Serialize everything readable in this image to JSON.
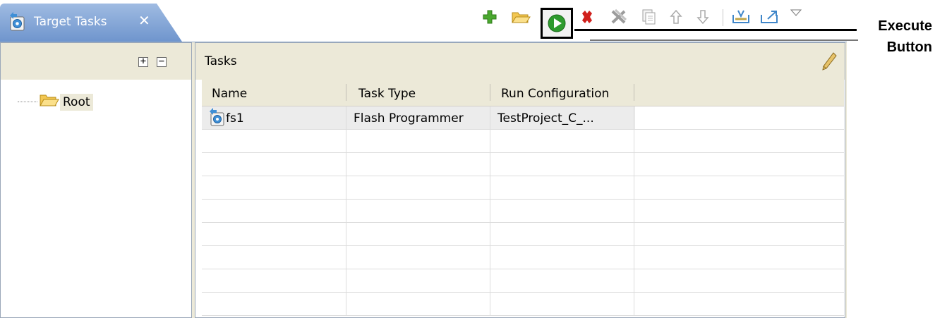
{
  "view": {
    "tab_title": "Target Tasks",
    "tab_close": "✕"
  },
  "toolbar": {
    "icons": [
      "add-icon",
      "open-folder-icon",
      "execute-icon",
      "delete-icon",
      "delete-all-icon",
      "copy-icon",
      "move-up-icon",
      "move-down-icon",
      "import-icon",
      "export-icon",
      "view-menu-icon"
    ]
  },
  "tree": {
    "expand_all": "+",
    "collapse_all": "−",
    "root_label": "Root"
  },
  "tasks": {
    "title": "Tasks",
    "columns": [
      "Name",
      "Task Type",
      "Run Configuration"
    ],
    "rows": [
      {
        "name": "fs1",
        "type": "Flash Programmer",
        "config": "TestProject_C_..."
      }
    ],
    "empty_rows": 8
  },
  "annotation": {
    "line1": "Execute",
    "line2": "Button"
  },
  "colors": {
    "tab_gradient_top": "#9fbbe2",
    "tab_gradient_bottom": "#6f95cd",
    "execute_green": "#2e9b2e",
    "delete_red": "#d0201c",
    "panel_bg": "#ece9d8"
  }
}
